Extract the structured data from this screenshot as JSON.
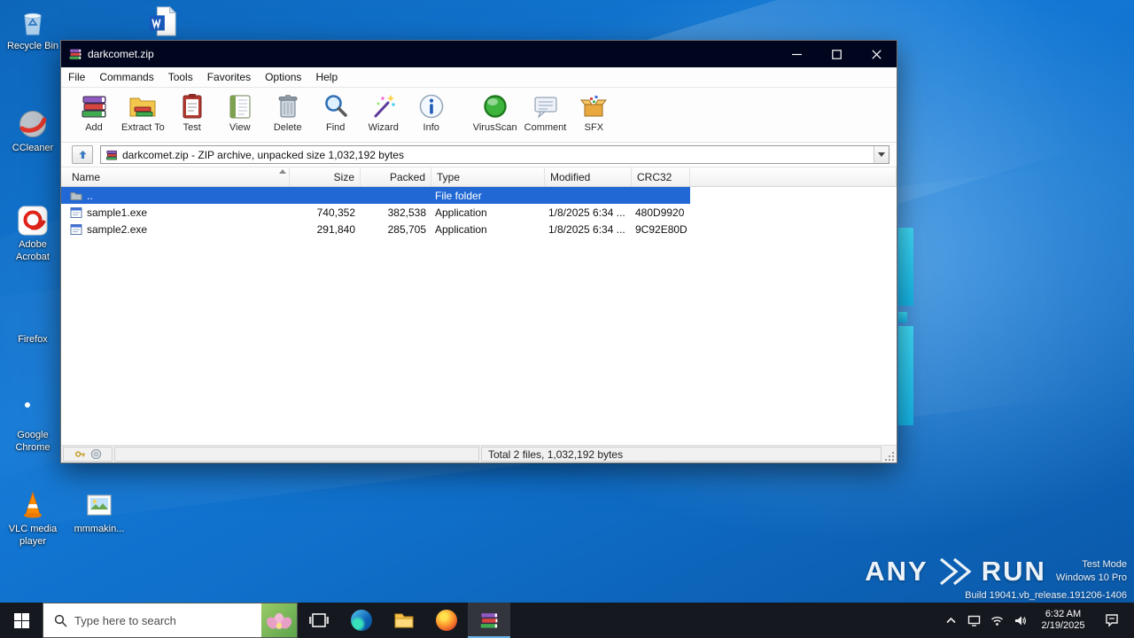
{
  "desktop": {
    "icons": {
      "recycle_bin": "Recycle Bin",
      "ccleaner": "CCleaner",
      "acrobat": "Adobe Acrobat",
      "firefox": "Firefox",
      "chrome": "Google Chrome",
      "vlc": "VLC media player",
      "image_file": "mmmakin..."
    },
    "watermark": {
      "brand_left": "ANY",
      "brand_right": "RUN",
      "line1": "Test Mode",
      "line2": "Windows 10 Pro",
      "line3": "Build 19041.vb_release.191206-1406"
    }
  },
  "winrar": {
    "title": "darkcomet.zip",
    "menu": [
      "File",
      "Commands",
      "Tools",
      "Favorites",
      "Options",
      "Help"
    ],
    "toolbar": [
      "Add",
      "Extract To",
      "Test",
      "View",
      "Delete",
      "Find",
      "Wizard",
      "Info",
      "VirusScan",
      "Comment",
      "SFX"
    ],
    "address": "darkcomet.zip - ZIP archive, unpacked size 1,032,192 bytes",
    "columns": [
      "Name",
      "Size",
      "Packed",
      "Type",
      "Modified",
      "CRC32"
    ],
    "rows": [
      {
        "name": "..",
        "size": "",
        "packed": "",
        "type": "File folder",
        "modified": "",
        "crc32": ""
      },
      {
        "name": "sample1.exe",
        "size": "740,352",
        "packed": "382,538",
        "type": "Application",
        "modified": "1/8/2025 6:34 ...",
        "crc32": "480D9920"
      },
      {
        "name": "sample2.exe",
        "size": "291,840",
        "packed": "285,705",
        "type": "Application",
        "modified": "1/8/2025 6:34 ...",
        "crc32": "9C92E80D"
      }
    ],
    "status_total": "Total 2 files, 1,032,192 bytes"
  },
  "taskbar": {
    "search_placeholder": "Type here to search",
    "time": "6:32 AM",
    "date": "2/19/2025"
  }
}
